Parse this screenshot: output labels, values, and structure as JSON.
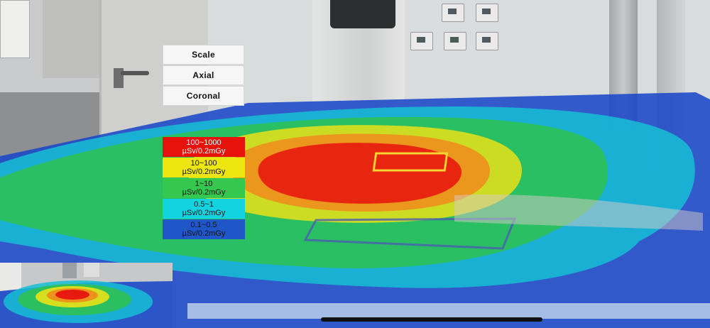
{
  "view_menu": {
    "items": [
      {
        "label": "Scale"
      },
      {
        "label": "Axial"
      },
      {
        "label": "Coronal"
      }
    ]
  },
  "legend": {
    "items": [
      {
        "range": "100~1000",
        "unit": "µSv/0.2mGy",
        "color": "#e8120c",
        "text_color": "#ffffff"
      },
      {
        "range": "10~100",
        "unit": "µSv/0.2mGy",
        "color": "#ece50e",
        "text_color": "#111111"
      },
      {
        "range": "1~10",
        "unit": "µSv/0.2mGy",
        "color": "#34c84e",
        "text_color": "#111111"
      },
      {
        "range": "0.5~1",
        "unit": "µSv/0.2mGy",
        "color": "#13d3e0",
        "text_color": "#111111"
      },
      {
        "range": "0.1~0.5",
        "unit": "µSv/0.2mGy",
        "color": "#1f57c9",
        "text_color": "#111111"
      }
    ]
  },
  "progress": {
    "fraction": 1.0
  }
}
